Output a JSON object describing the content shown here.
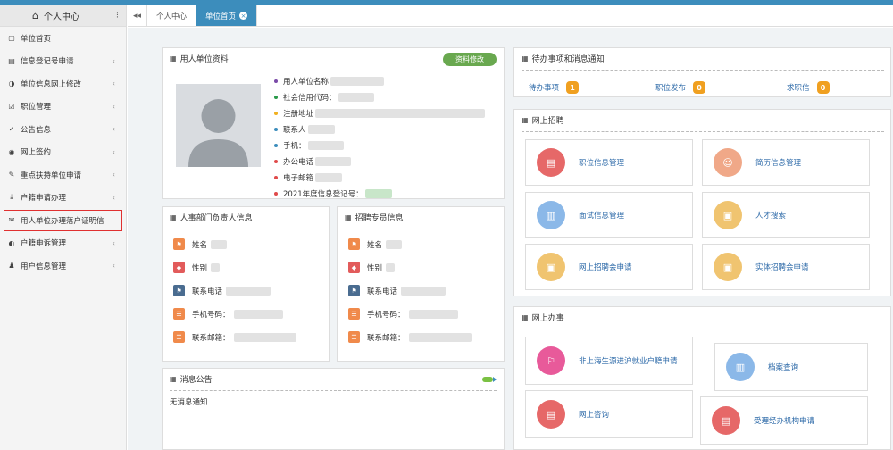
{
  "sidebar": {
    "header": "个人中心",
    "items": [
      {
        "label": "单位首页",
        "icon": "home-icon",
        "chev": false
      },
      {
        "label": "信息登记号申请",
        "icon": "doc-icon",
        "chev": true
      },
      {
        "label": "单位信息网上修改",
        "icon": "edit-icon",
        "chev": true
      },
      {
        "label": "职位管理",
        "icon": "check-icon",
        "chev": true
      },
      {
        "label": "公告信息",
        "icon": "check-icon",
        "chev": true
      },
      {
        "label": "网上签约",
        "icon": "eye-icon",
        "chev": true
      },
      {
        "label": "重点扶持单位申请",
        "icon": "pen-icon",
        "chev": true
      },
      {
        "label": "户籍申请办理",
        "icon": "download-icon",
        "chev": true
      },
      {
        "label": "用人单位办理落户证明信",
        "icon": "mail-icon",
        "chev": false
      },
      {
        "label": "户籍申诉管理",
        "icon": "circle-icon",
        "chev": true
      },
      {
        "label": "用户信息管理",
        "icon": "user-icon",
        "chev": true
      }
    ]
  },
  "tabs": {
    "nav": "◂◂",
    "items": [
      {
        "label": "个人中心"
      },
      {
        "label": "单位首页"
      }
    ]
  },
  "profile": {
    "title": "用人单位资料",
    "edit_btn": "资料修改",
    "fields": [
      {
        "label": "用人单位名称",
        "color": "#7a4aa8"
      },
      {
        "label": "社会信用代码：",
        "color": "#2a9a4a"
      },
      {
        "label": "注册地址",
        "color": "#f0b020"
      },
      {
        "label": "联系人",
        "color": "#3c8dbc"
      },
      {
        "label": "手机：",
        "color": "#3c8dbc"
      },
      {
        "label": "办公电话",
        "color": "#e04a4a"
      },
      {
        "label": "电子邮箱",
        "color": "#e04a4a"
      },
      {
        "label": "2021年度信息登记号：",
        "color": "#e04a4a"
      }
    ]
  },
  "hr_contact": {
    "title": "人事部门负责人信息",
    "fields": [
      {
        "label": "姓名",
        "icon": "flag-icon",
        "cls": "or"
      },
      {
        "label": "性别",
        "icon": "tag-icon",
        "cls": "rd"
      },
      {
        "label": "联系电话",
        "icon": "flag-icon",
        "cls": "nv"
      },
      {
        "label": "手机号码：",
        "icon": "list-icon",
        "cls": "or"
      },
      {
        "label": "联系邮箱：",
        "icon": "list-icon",
        "cls": "or"
      }
    ]
  },
  "recruit_contact": {
    "title": "招聘专员信息",
    "fields": [
      {
        "label": "姓名",
        "icon": "flag-icon",
        "cls": "or"
      },
      {
        "label": "性别",
        "icon": "tag-icon",
        "cls": "rd"
      },
      {
        "label": "联系电话",
        "icon": "flag-icon",
        "cls": "nv"
      },
      {
        "label": "手机号码：",
        "icon": "list-icon",
        "cls": "or"
      },
      {
        "label": "联系邮箱：",
        "icon": "list-icon",
        "cls": "or"
      }
    ]
  },
  "todo": {
    "title": "待办事项和消息通知",
    "items": [
      {
        "label": "待办事项",
        "count": "1"
      },
      {
        "label": "职位发布",
        "count": "0"
      },
      {
        "label": "求职信",
        "count": "0"
      }
    ]
  },
  "recruit": {
    "title": "网上招聘",
    "cards": [
      {
        "label": "职位信息管理",
        "icon": "clipboard-icon"
      },
      {
        "label": "简历信息管理",
        "icon": "people-icon"
      },
      {
        "label": "面试信息管理",
        "icon": "bars-icon"
      },
      {
        "label": "人才搜索",
        "icon": "image-icon"
      },
      {
        "label": "网上招聘会申请",
        "icon": "image-icon"
      },
      {
        "label": "实体招聘会申请",
        "icon": "image-icon"
      }
    ]
  },
  "office": {
    "title": "网上办事",
    "cards": [
      {
        "label": "非上海生源进沪就业户籍申请",
        "icon": "signpost-icon"
      },
      {
        "label": "档案查询",
        "icon": "bars-icon"
      },
      {
        "label": "网上咨询",
        "icon": "clipboard-icon"
      },
      {
        "label": "受理经办机构申请",
        "icon": "clipboard-icon"
      }
    ]
  },
  "notice": {
    "title": "消息公告",
    "text": "无消息通知"
  },
  "colors": {
    "primary": "#3c8dbc",
    "edit_btn": "#69a84f",
    "badge": "#f0a020",
    "highlight": "#e03030"
  }
}
